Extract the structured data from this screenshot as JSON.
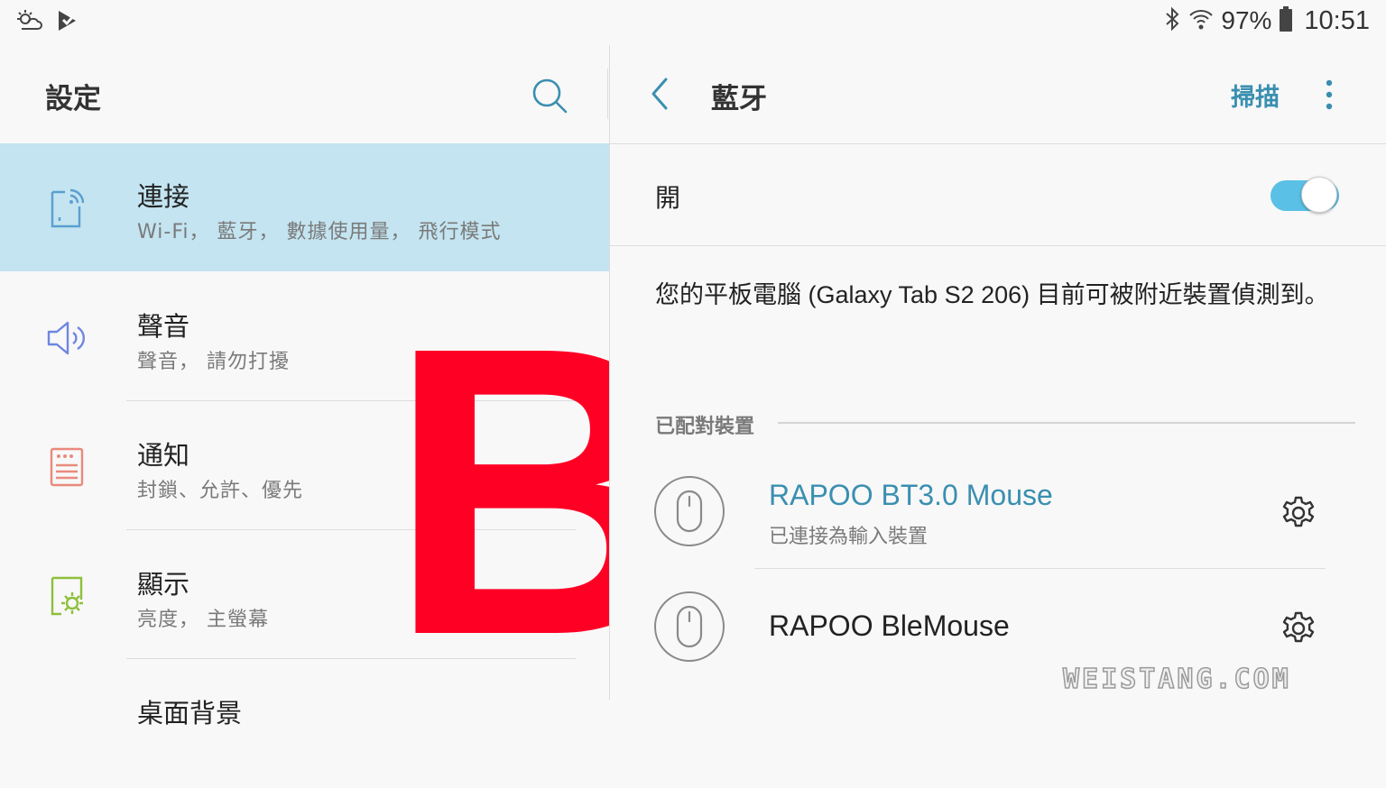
{
  "status_bar": {
    "battery_percent": "97%",
    "time": "10:51",
    "left_icons": [
      "weather-icon",
      "play-store-download-icon"
    ],
    "right_icons": [
      "bluetooth-icon",
      "wifi-icon",
      "battery-icon"
    ]
  },
  "left_pane": {
    "title": "設定",
    "search_icon": "search-icon",
    "items": [
      {
        "title": "連接",
        "subtitle": "Wi-Fi， 藍牙， 數據使用量， 飛行模式",
        "icon": "connections-icon",
        "icon_color": "#5b9fcf",
        "selected": true
      },
      {
        "title": "聲音",
        "subtitle": "聲音， 請勿打擾",
        "icon": "speaker-icon",
        "icon_color": "#6d87e0",
        "selected": false
      },
      {
        "title": "通知",
        "subtitle": "封鎖、允許、優先",
        "icon": "notification-icon",
        "icon_color": "#e98a7c",
        "selected": false
      },
      {
        "title": "顯示",
        "subtitle": "亮度， 主螢幕",
        "icon": "display-icon",
        "icon_color": "#8fbf3b",
        "selected": false
      },
      {
        "title": "桌面背景",
        "subtitle": "",
        "icon": "",
        "selected": false
      }
    ],
    "overlay_letter": "B"
  },
  "right_pane": {
    "title": "藍牙",
    "scan_label": "掃描",
    "toggle_label": "開",
    "toggle_on": true,
    "description": "您的平板電腦 (Galaxy Tab S2 206) 目前可被附近裝置偵測到。",
    "section_title": "已配對裝置",
    "devices": [
      {
        "name": "RAPOO BT3.0 Mouse",
        "status": "已連接為輸入裝置",
        "connected": true,
        "icon": "mouse-icon"
      },
      {
        "name": "RAPOO BleMouse",
        "status": "",
        "connected": false,
        "icon": "mouse-icon"
      }
    ]
  },
  "watermark": "WEISTANG.COM",
  "colors": {
    "accent": "#3a8fb0",
    "selected_bg": "#c3e4f0",
    "toggle_on": "#5bc0e6",
    "overlay_red": "#ff0025"
  }
}
